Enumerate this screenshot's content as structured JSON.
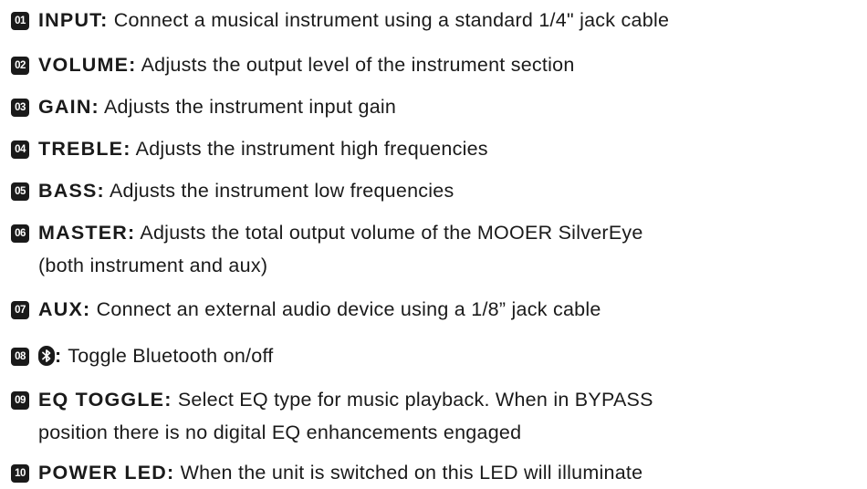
{
  "items": [
    {
      "num": "01",
      "heading": "INPUT:",
      "text": " Connect a musical instrument using a standard 1/4\" jack cable"
    },
    {
      "num": "02",
      "heading": "VOLUME:",
      "text": " Adjusts the output level of the instrument section"
    },
    {
      "num": "03",
      "heading": "GAIN:",
      "text": " Adjusts the instrument input gain"
    },
    {
      "num": "04",
      "heading": "TREBLE:",
      "text": " Adjusts the instrument high frequencies"
    },
    {
      "num": "05",
      "heading": "BASS:",
      "text": " Adjusts the instrument low frequencies"
    },
    {
      "num": "06",
      "heading": "MASTER:",
      "text": " Adjusts the total output volume of the MOOER SilverEye",
      "text2": "(both instrument and aux)"
    },
    {
      "num": "07",
      "heading": "AUX:",
      "text": " Connect an external audio device using a 1/8” jack cable"
    },
    {
      "num": "08",
      "heading": ":",
      "heading_icon": "bluetooth-icon",
      "text": " Toggle Bluetooth on/off"
    },
    {
      "num": "09",
      "heading": "EQ TOGGLE:",
      "text": " Select EQ type for music playback. When in BYPASS",
      "text2": "position there is no digital EQ enhancements engaged"
    },
    {
      "num": "10",
      "heading": "POWER LED:",
      "text": " When the unit is switched on this LED will illuminate"
    }
  ]
}
